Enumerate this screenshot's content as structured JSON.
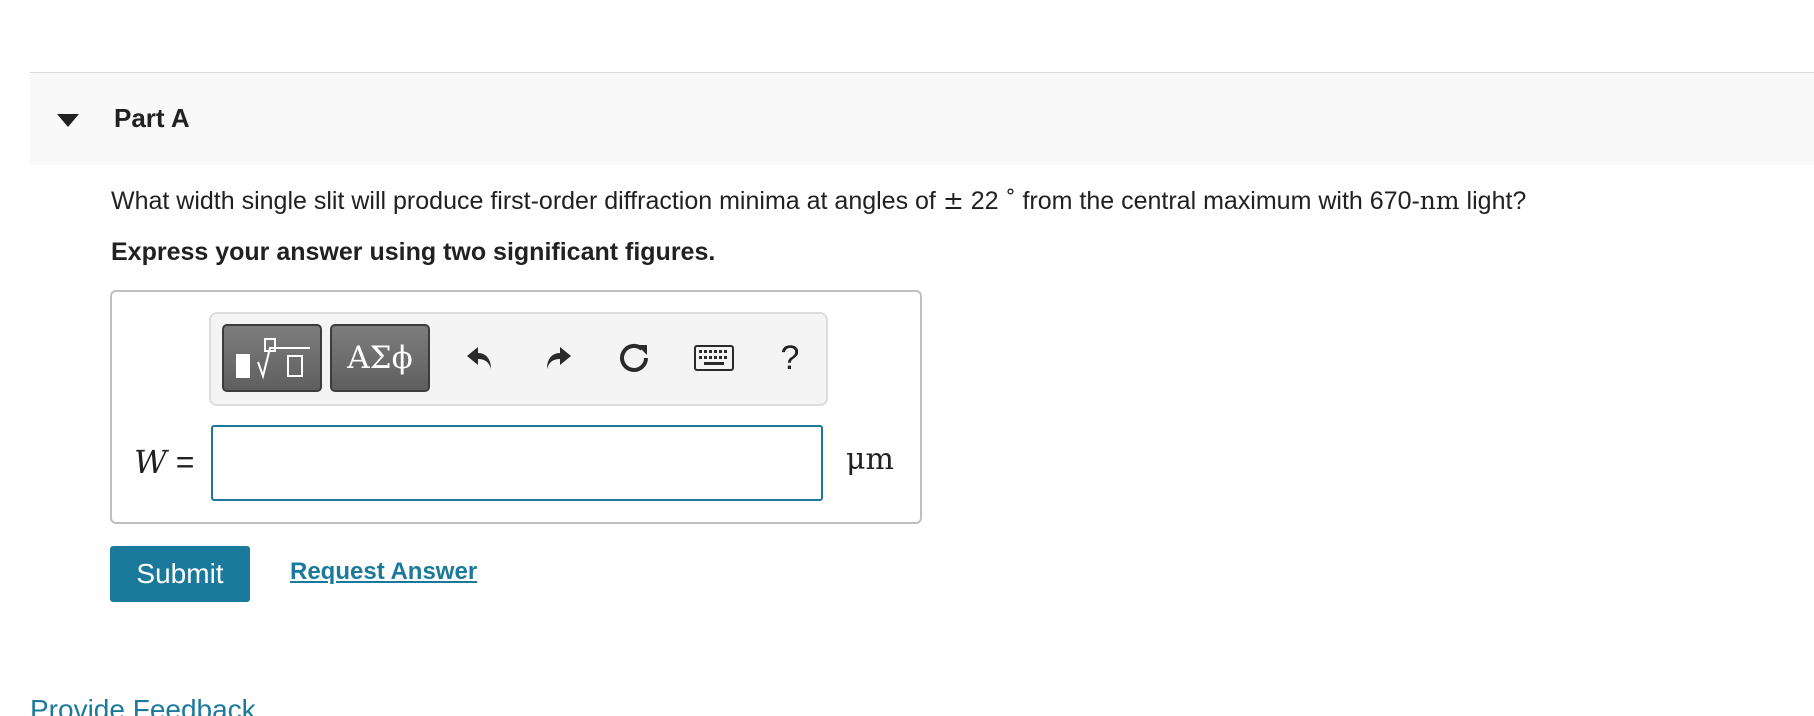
{
  "part": {
    "title": "Part A"
  },
  "question": {
    "text_before": "What width single slit will produce first-order diffraction minima at angles of ",
    "pm_symbol": "±",
    "angle": "22",
    "degree_symbol": "°",
    "text_middle": " from the central maximum with 670-",
    "wavelength_unit": "nm",
    "text_after": " light?"
  },
  "instruction": "Express your answer using two significant figures.",
  "toolbar": {
    "symbols_label": "ΑΣϕ",
    "help_label": "?",
    "buttons": [
      "templates-icon",
      "greek-symbols",
      "undo-icon",
      "redo-icon",
      "reset-icon",
      "keyboard-icon",
      "help"
    ]
  },
  "answer": {
    "variable": "W",
    "equals": "=",
    "value": "",
    "unit": "μm"
  },
  "actions": {
    "submit_label": "Submit",
    "request_answer_label": "Request Answer"
  },
  "footer": {
    "feedback_label": "Provide Feedback"
  },
  "colors": {
    "accent": "#1b7a9b",
    "header_bg": "#f9f9f9",
    "toolbar_button": "#6e6e6e"
  }
}
